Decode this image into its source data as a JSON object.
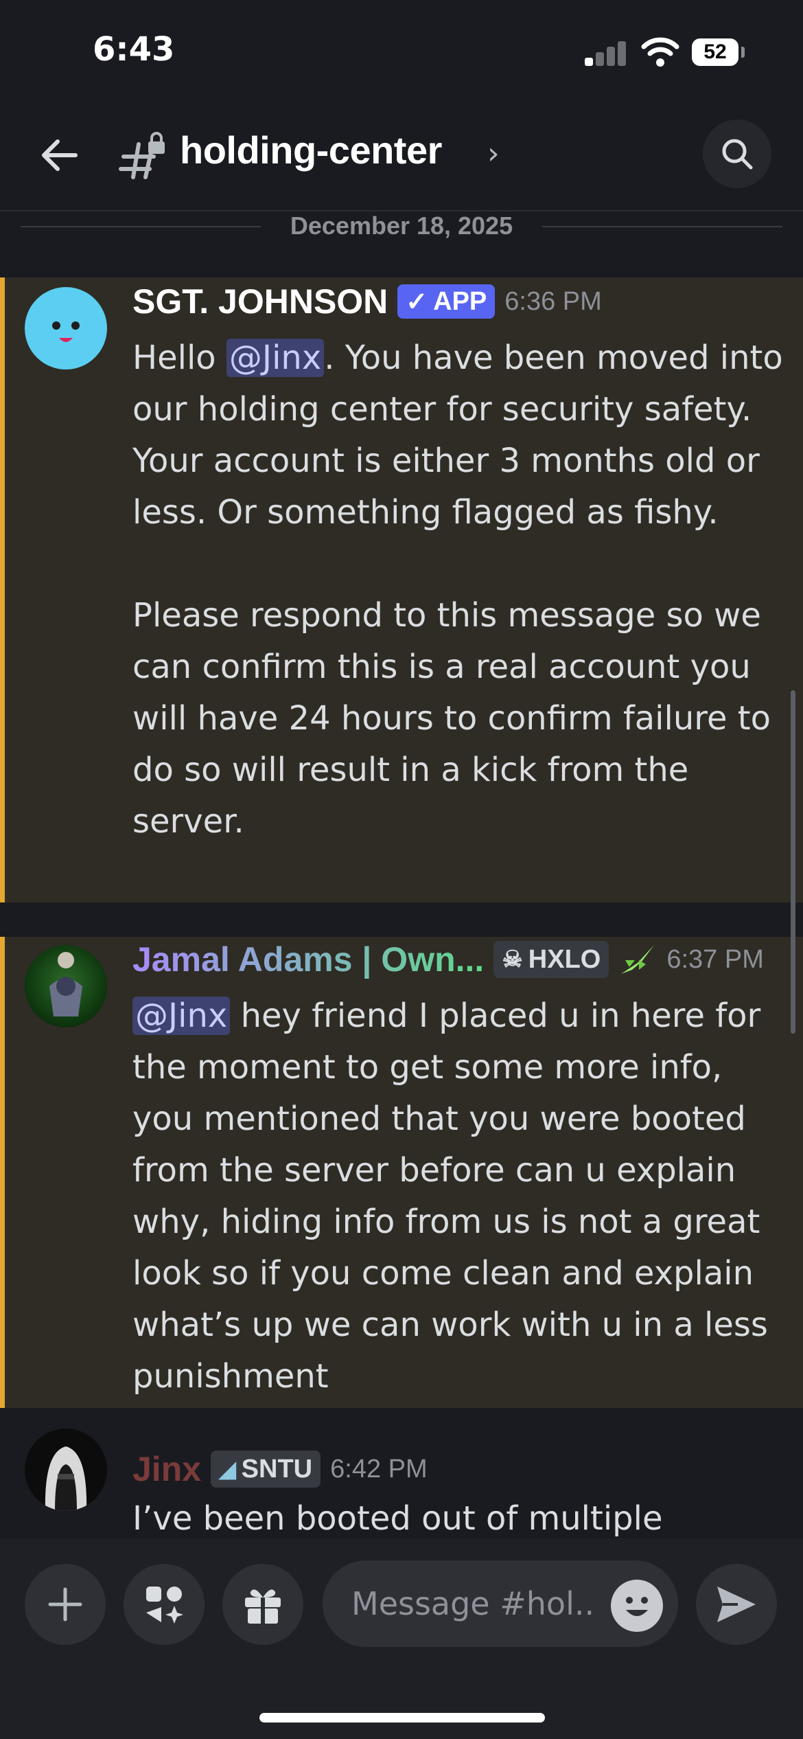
{
  "status_bar": {
    "time": "6:43",
    "battery": "52"
  },
  "header": {
    "channel_name": "holding-center",
    "chevron": "›"
  },
  "date_divider": "December 18, 2025",
  "messages": [
    {
      "username": "SGT. JOHNSON",
      "username_color": "#ffffff",
      "badge": "APP",
      "badge_check": "✓",
      "time": "6:36 PM",
      "mention": "@Jinx",
      "text_after_mention": ". You have been moved into our holding center for security safety. Your account is either 3 months old or less. Or something flagged as fishy.\n\nPlease respond to this message so we can confirm this is a real account you will have 24 hours to confirm failure to do so will result in a kick from the server.",
      "text_before_mention": "Hello ",
      "highlighted": true
    },
    {
      "username": "Jamal Adams | Own...",
      "username_gradient": [
        "#a78bfa",
        "#5fd88a"
      ],
      "tag": "HXLO",
      "time": "6:37 PM",
      "mention": "@Jinx",
      "text_after_mention": " hey friend I placed u in here for the moment to get some more info, you mentioned that you were booted from the server before can u explain why, hiding info from us is not a great look so if you come clean and explain what’s up we can work with u in a less punishment",
      "highlighted": true
    },
    {
      "username": "Jinx",
      "username_color": "#7a3b3b",
      "tag": "SNTU",
      "time": "6:42 PM",
      "text": "I’ve been booted out of multiple"
    }
  ],
  "composer": {
    "placeholder": "Message #hol.."
  },
  "colors": {
    "highlight_bar": "#e5a72f",
    "highlight_bg": "#2e2c24",
    "background": "#1a1b20",
    "mention_bg": "#3d4270",
    "app_badge": "#5865f2"
  },
  "icons": [
    "back-arrow-icon",
    "hashtag-lock-icon",
    "search-icon",
    "plus-icon",
    "apps-icon",
    "gift-icon",
    "emoji-icon",
    "send-icon"
  ]
}
